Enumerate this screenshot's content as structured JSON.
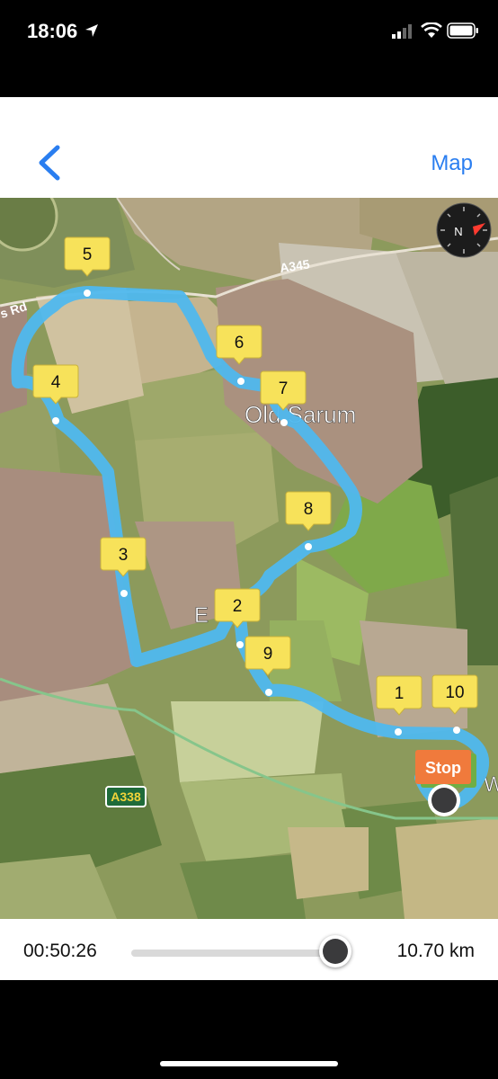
{
  "status_bar": {
    "time": "18:06"
  },
  "nav": {
    "map_label": "Map"
  },
  "map": {
    "place_labels": {
      "old_sarum": "Old Sarum",
      "road_partial": "s Rd",
      "place_e": "E",
      "place_w": "W"
    },
    "road_labels": {
      "a345": "A345",
      "a338": "A338"
    },
    "markers": [
      "1",
      "2",
      "3",
      "4",
      "5",
      "6",
      "7",
      "8",
      "9",
      "10"
    ],
    "stop_label": "Stop"
  },
  "playback": {
    "elapsed": "00:50:26",
    "distance": "10.70 km",
    "progress": 0.93
  },
  "colors": {
    "accent": "#2a7ef0",
    "route": "#4fb8ee",
    "marker": "#f7e25a",
    "stop": "#f07a3c"
  }
}
